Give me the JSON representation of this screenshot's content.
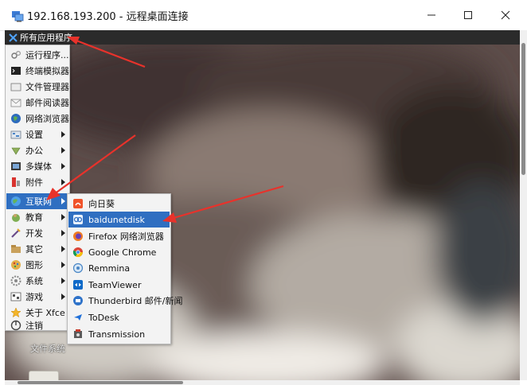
{
  "window": {
    "title": "192.168.193.200 - 远程桌面连接",
    "controls": {
      "minimize": "minimize-icon",
      "maximize": "maximize-icon",
      "close": "close-icon"
    }
  },
  "panel": {
    "apps_menu_label": "所有应用程序"
  },
  "main_menu": {
    "items": [
      {
        "label": "运行程序...",
        "icon": "run-icon",
        "submenu": false
      },
      {
        "label": "终端模拟器",
        "icon": "terminal-icon",
        "submenu": false
      },
      {
        "label": "文件管理器",
        "icon": "folder-icon",
        "submenu": false
      },
      {
        "label": "邮件阅读器",
        "icon": "mail-icon",
        "submenu": false
      },
      {
        "label": "网络浏览器",
        "icon": "globe-icon",
        "submenu": false
      },
      {
        "label": "设置",
        "icon": "settings-icon",
        "submenu": true
      },
      {
        "label": "办公",
        "icon": "office-icon",
        "submenu": true
      },
      {
        "label": "多媒体",
        "icon": "multimedia-icon",
        "submenu": true
      },
      {
        "label": "附件",
        "icon": "accessories-icon",
        "submenu": true
      },
      {
        "label": "互联网",
        "icon": "internet-icon",
        "submenu": true,
        "selected": true
      },
      {
        "label": "教育",
        "icon": "education-icon",
        "submenu": true
      },
      {
        "label": "开发",
        "icon": "development-icon",
        "submenu": true
      },
      {
        "label": "其它",
        "icon": "other-icon",
        "submenu": true
      },
      {
        "label": "图形",
        "icon": "graphics-icon",
        "submenu": true
      },
      {
        "label": "系统",
        "icon": "system-icon",
        "submenu": true
      },
      {
        "label": "游戏",
        "icon": "games-icon",
        "submenu": true
      },
      {
        "label": "关于 Xfce",
        "icon": "star-icon",
        "submenu": false
      },
      {
        "label": "注销",
        "icon": "logout-icon",
        "submenu": false
      }
    ]
  },
  "internet_submenu": {
    "items": [
      {
        "label": "向日葵",
        "icon": "sunlogin-icon"
      },
      {
        "label": "baidunetdisk",
        "icon": "baidunetdisk-icon",
        "selected": true
      },
      {
        "label": "Firefox 网络浏览器",
        "icon": "firefox-icon"
      },
      {
        "label": "Google Chrome",
        "icon": "chrome-icon"
      },
      {
        "label": "Remmina",
        "icon": "remmina-icon"
      },
      {
        "label": "TeamViewer",
        "icon": "teamviewer-icon"
      },
      {
        "label": "Thunderbird 邮件/新闻",
        "icon": "thunderbird-icon"
      },
      {
        "label": "ToDesk",
        "icon": "todesk-icon"
      },
      {
        "label": "Transmission",
        "icon": "transmission-icon"
      }
    ]
  },
  "desktop": {
    "icon_label": "文件系统"
  },
  "colors": {
    "selection": "#2f6fc1",
    "annotation_arrow": "#e8322b",
    "panel": "#2b2b2b"
  }
}
